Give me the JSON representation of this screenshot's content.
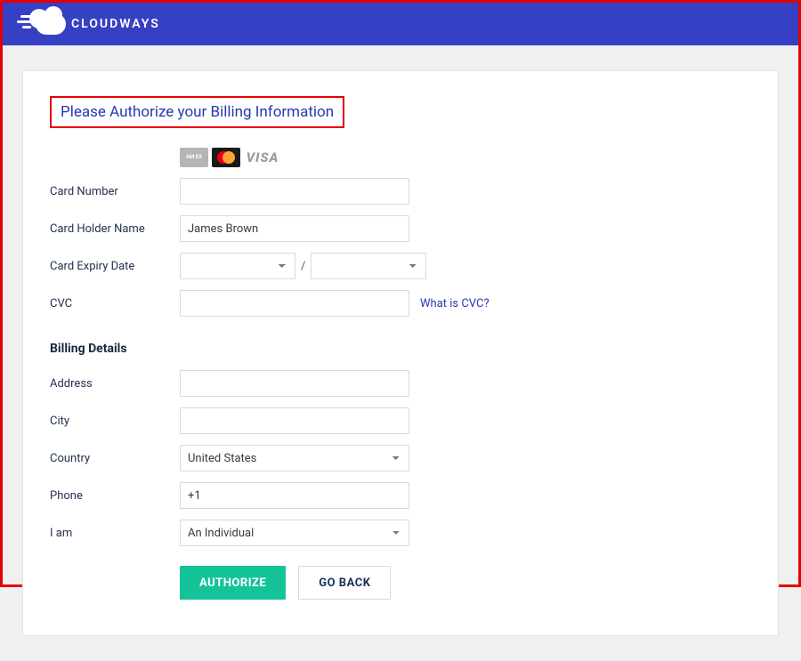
{
  "header": {
    "brand": "CLOUDWAYS"
  },
  "page": {
    "title": "Please Authorize your Billing Information",
    "card_logos": {
      "amex": "AM EX",
      "visa": "VISA"
    },
    "card_form": {
      "number_label": "Card Number",
      "number_value": "",
      "holder_label": "Card Holder Name",
      "holder_value": "James Brown",
      "expiry_label": "Card Expiry Date",
      "expiry_month": "",
      "expiry_year": "",
      "expiry_separator": "/",
      "cvc_label": "CVC",
      "cvc_value": "",
      "cvc_help": "What is CVC?"
    },
    "billing": {
      "heading": "Billing Details",
      "address_label": "Address",
      "address_value": "",
      "city_label": "City",
      "city_value": "",
      "country_label": "Country",
      "country_value": "United States",
      "phone_label": "Phone",
      "phone_value": "+1",
      "iam_label": "I am",
      "iam_value": "An Individual"
    },
    "actions": {
      "authorize": "AUTHORIZE",
      "go_back": "GO BACK"
    }
  }
}
